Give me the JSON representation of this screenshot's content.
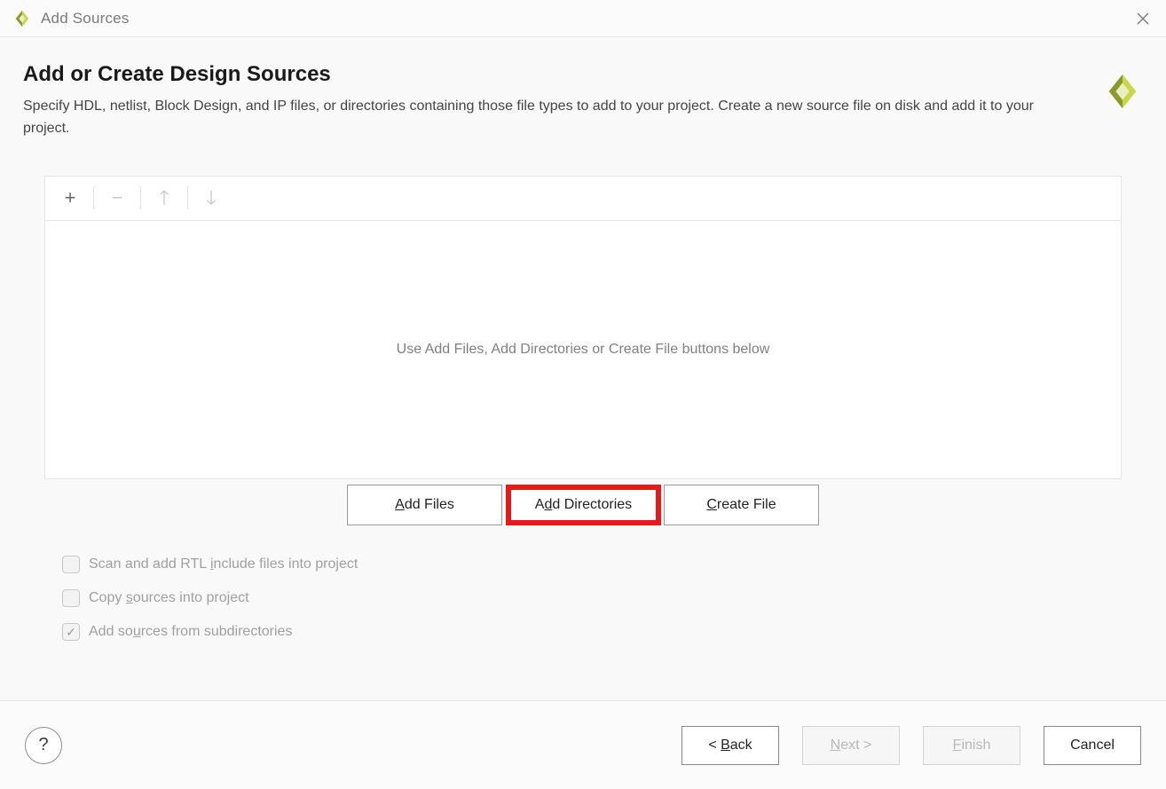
{
  "window": {
    "title": "Add Sources"
  },
  "header": {
    "heading": "Add or Create Design Sources",
    "description": "Specify HDL, netlist, Block Design, and IP files, or directories containing those file types to add to your project. Create a new source file on disk and add it to your project."
  },
  "toolbar": {
    "add_icon": "plus-icon",
    "remove_icon": "minus-icon",
    "up_icon": "arrow-up-icon",
    "down_icon": "arrow-down-icon"
  },
  "panel": {
    "placeholder": "Use Add Files, Add Directories or Create File buttons below"
  },
  "mid_buttons": {
    "add_files": {
      "pre": "",
      "m": "A",
      "post": "dd Files"
    },
    "add_directories": {
      "pre": "A",
      "m": "d",
      "post": "d Directories"
    },
    "create_file": {
      "pre": "",
      "m": "C",
      "post": "reate File"
    }
  },
  "checks": {
    "scan": {
      "checked": false,
      "pre": "Scan and add RTL ",
      "m": "i",
      "post": "nclude files into project"
    },
    "copy": {
      "checked": false,
      "pre": "Copy ",
      "m": "s",
      "post": "ources into project"
    },
    "sub": {
      "checked": true,
      "pre": "Add so",
      "m": "u",
      "post": "rces from subdirectories"
    }
  },
  "footer": {
    "help": {
      "label": "?"
    },
    "back": {
      "disabled": false,
      "pre": "< ",
      "m": "B",
      "post": "ack"
    },
    "next": {
      "disabled": true,
      "pre": "",
      "m": "N",
      "post": "ext >"
    },
    "finish": {
      "disabled": true,
      "pre": "",
      "m": "F",
      "post": "inish"
    },
    "cancel": {
      "disabled": false,
      "label": "Cancel"
    }
  },
  "highlight": "add_directories"
}
